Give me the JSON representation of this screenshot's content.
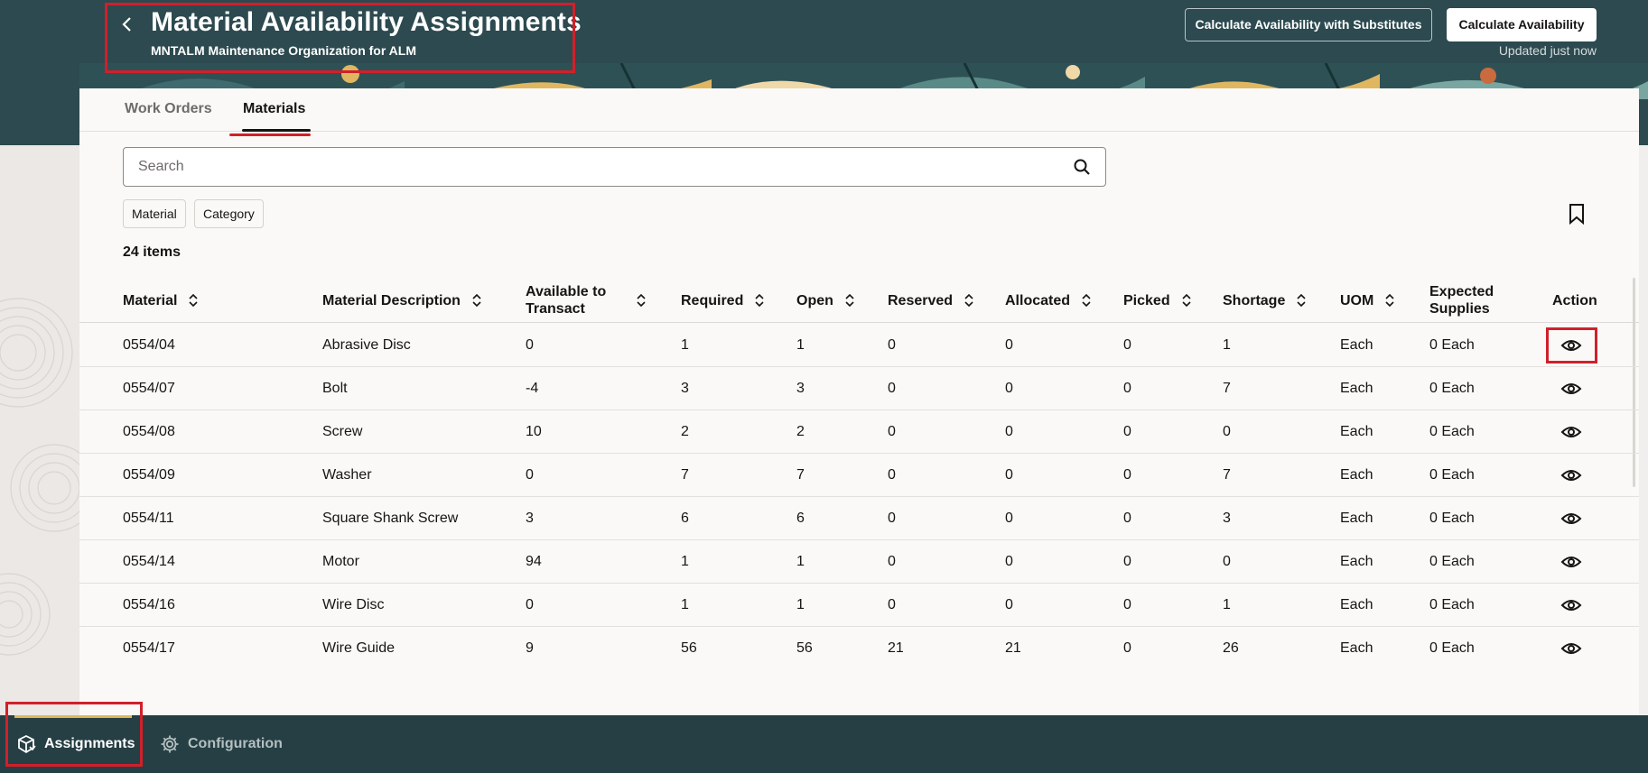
{
  "header": {
    "back_icon": "chevron-left-icon",
    "title": "Material Availability Assignments",
    "subtitle": "MNTALM Maintenance Organization for ALM",
    "calc_substitutes_label": "Calculate Availability with Substitutes",
    "calc_label": "Calculate Availability",
    "updated_text": "Updated just now"
  },
  "tabs": [
    {
      "label": "Work Orders",
      "active": false
    },
    {
      "label": "Materials",
      "active": true
    }
  ],
  "search": {
    "placeholder": "Search",
    "value": "",
    "icon": "search-icon"
  },
  "filters": [
    {
      "label": "Material"
    },
    {
      "label": "Category"
    }
  ],
  "item_count": "24 items",
  "table": {
    "columns": [
      {
        "key": "material",
        "label": "Material",
        "sortable": true
      },
      {
        "key": "description",
        "label": "Material Description",
        "sortable": true
      },
      {
        "key": "available",
        "label": "Available to Transact",
        "sortable": true
      },
      {
        "key": "required",
        "label": "Required",
        "sortable": true
      },
      {
        "key": "open",
        "label": "Open",
        "sortable": true
      },
      {
        "key": "reserved",
        "label": "Reserved",
        "sortable": true
      },
      {
        "key": "allocated",
        "label": "Allocated",
        "sortable": true
      },
      {
        "key": "picked",
        "label": "Picked",
        "sortable": true
      },
      {
        "key": "shortage",
        "label": "Shortage",
        "sortable": true
      },
      {
        "key": "uom",
        "label": "UOM",
        "sortable": true
      },
      {
        "key": "expected",
        "label": "Expected Supplies",
        "sortable": false
      },
      {
        "key": "action",
        "label": "Action",
        "sortable": false
      }
    ],
    "rows": [
      {
        "material": "0554/04",
        "description": "Abrasive Disc",
        "available": "0",
        "required": "1",
        "open": "1",
        "reserved": "0",
        "allocated": "0",
        "picked": "0",
        "shortage": "1",
        "uom": "Each",
        "expected": "0 Each",
        "action_icon": "eye-icon"
      },
      {
        "material": "0554/07",
        "description": "Bolt",
        "available": "-4",
        "required": "3",
        "open": "3",
        "reserved": "0",
        "allocated": "0",
        "picked": "0",
        "shortage": "7",
        "uom": "Each",
        "expected": "0 Each",
        "action_icon": "eye-icon"
      },
      {
        "material": "0554/08",
        "description": "Screw",
        "available": "10",
        "required": "2",
        "open": "2",
        "reserved": "0",
        "allocated": "0",
        "picked": "0",
        "shortage": "0",
        "uom": "Each",
        "expected": "0 Each",
        "action_icon": "eye-icon"
      },
      {
        "material": "0554/09",
        "description": "Washer",
        "available": "0",
        "required": "7",
        "open": "7",
        "reserved": "0",
        "allocated": "0",
        "picked": "0",
        "shortage": "7",
        "uom": "Each",
        "expected": "0 Each",
        "action_icon": "eye-icon"
      },
      {
        "material": "0554/11",
        "description": "Square Shank Screw",
        "available": "3",
        "required": "6",
        "open": "6",
        "reserved": "0",
        "allocated": "0",
        "picked": "0",
        "shortage": "3",
        "uom": "Each",
        "expected": "0 Each",
        "action_icon": "eye-icon"
      },
      {
        "material": "0554/14",
        "description": "Motor",
        "available": "94",
        "required": "1",
        "open": "1",
        "reserved": "0",
        "allocated": "0",
        "picked": "0",
        "shortage": "0",
        "uom": "Each",
        "expected": "0 Each",
        "action_icon": "eye-icon"
      },
      {
        "material": "0554/16",
        "description": "Wire Disc",
        "available": "0",
        "required": "1",
        "open": "1",
        "reserved": "0",
        "allocated": "0",
        "picked": "0",
        "shortage": "1",
        "uom": "Each",
        "expected": "0 Each",
        "action_icon": "eye-icon"
      },
      {
        "material": "0554/17",
        "description": "Wire Guide",
        "available": "9",
        "required": "56",
        "open": "56",
        "reserved": "21",
        "allocated": "21",
        "picked": "0",
        "shortage": "26",
        "uom": "Each",
        "expected": "0 Each",
        "action_icon": "eye-icon"
      }
    ]
  },
  "bottom_nav": [
    {
      "label": "Assignments",
      "icon": "assignments-icon",
      "active": true
    },
    {
      "label": "Configuration",
      "icon": "gear-icon",
      "active": false
    }
  ],
  "colors": {
    "header_bg": "#2c4a4f",
    "footer_bg": "#253f44",
    "highlight": "#d0202a",
    "active_indicator": "#e2b653"
  }
}
